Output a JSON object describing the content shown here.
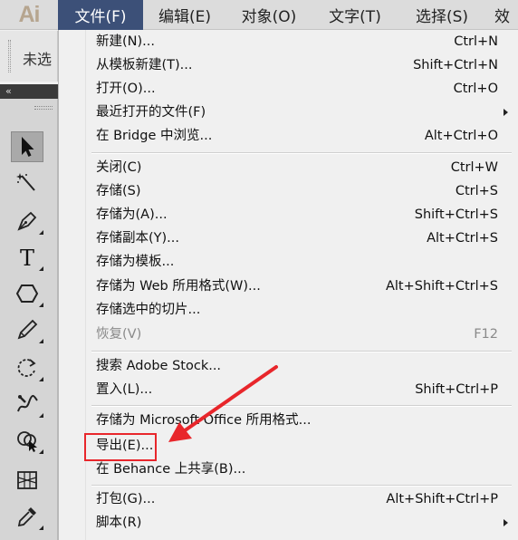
{
  "app": {
    "logo": "Ai"
  },
  "menubar": {
    "items": [
      {
        "label": "文件(F)",
        "active": true
      },
      {
        "label": "编辑(E)"
      },
      {
        "label": "对象(O)"
      },
      {
        "label": "文字(T)"
      },
      {
        "label": "选择(S)"
      },
      {
        "label": "效"
      }
    ]
  },
  "control_strip": {
    "selection_label": "未选"
  },
  "toolbar": {
    "collapse_icon": "collapse-double-arrow-icon",
    "tools": [
      "selection-tool-icon",
      "magic-wand-tool-icon",
      "pen-tool-icon",
      "type-tool-icon",
      "shape-tool-icon",
      "pencil-tool-icon",
      "rotate-tool-icon",
      "warp-tool-icon",
      "shape-builder-tool-icon",
      "perspective-grid-tool-icon",
      "eyedropper-tool-icon"
    ]
  },
  "file_menu": {
    "groups": [
      [
        {
          "label": "新建(N)...",
          "shortcut": "Ctrl+N"
        },
        {
          "label": "从模板新建(T)...",
          "shortcut": "Shift+Ctrl+N"
        },
        {
          "label": "打开(O)...",
          "shortcut": "Ctrl+O"
        },
        {
          "label": "最近打开的文件(F)",
          "submenu": true
        },
        {
          "label": "在 Bridge 中浏览...",
          "shortcut": "Alt+Ctrl+O"
        }
      ],
      [
        {
          "label": "关闭(C)",
          "shortcut": "Ctrl+W"
        },
        {
          "label": "存储(S)",
          "shortcut": "Ctrl+S"
        },
        {
          "label": "存储为(A)...",
          "shortcut": "Shift+Ctrl+S"
        },
        {
          "label": "存储副本(Y)...",
          "shortcut": "Alt+Ctrl+S"
        },
        {
          "label": "存储为模板..."
        },
        {
          "label": "存储为 Web 所用格式(W)...",
          "shortcut": "Alt+Shift+Ctrl+S"
        },
        {
          "label": "存储选中的切片..."
        },
        {
          "label": "恢复(V)",
          "shortcut": "F12",
          "disabled": true
        }
      ],
      [
        {
          "label": "搜索 Adobe Stock..."
        },
        {
          "label": "置入(L)...",
          "shortcut": "Shift+Ctrl+P"
        }
      ],
      [
        {
          "label": "存储为 Microsoft Office 所用格式..."
        },
        {
          "label": "导出(E)...",
          "highlighted": true
        },
        {
          "label": "在 Behance 上共享(B)..."
        }
      ],
      [
        {
          "label": "打包(G)...",
          "shortcut": "Alt+Shift+Ctrl+P"
        },
        {
          "label": "脚本(R)",
          "submenu": true
        }
      ]
    ]
  },
  "colors": {
    "menubar_bg": "#dcdcdc",
    "active_menu_bg": "#3c5078",
    "annotation_red": "#e8262b",
    "logo_color": "#b6a58f"
  }
}
